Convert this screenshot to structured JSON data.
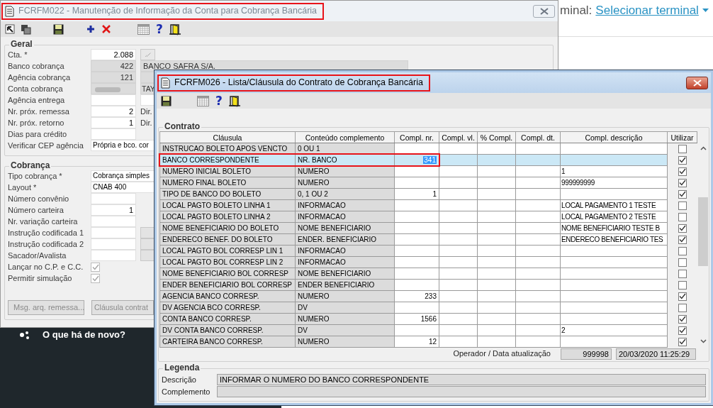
{
  "backdrop": {
    "terminal_prefix": "minal:",
    "terminal_link": "Selecionar terminal",
    "news_label": "O que há de novo?"
  },
  "account_window": {
    "title": "FCRFM022 - Manutenção de Informação da Conta para Cobrança Bancária",
    "active": false,
    "marked": true,
    "toolbar": [
      {
        "kind": "pointer"
      },
      {
        "kind": "windows"
      },
      {
        "kind": "save"
      },
      {
        "kind": "add"
      },
      {
        "kind": "delete"
      },
      {
        "kind": "grid"
      },
      {
        "kind": "help",
        "label": "?"
      },
      {
        "kind": "exit"
      }
    ],
    "sections": [
      {
        "title": "Geral",
        "rows": [
          {
            "kind": "fields",
            "label": "Cta. *",
            "fields": [
              {
                "kind": "number",
                "value": "2.088",
                "readonly": false
              },
              {
                "kind": "lookup"
              }
            ]
          },
          {
            "kind": "fields",
            "label": "Banco cobrança",
            "fields": [
              {
                "kind": "number",
                "value": "422",
                "readonly": true
              },
              {
                "kind": "text",
                "value": "BANCO SAFRA S/A.",
                "readonly": true
              }
            ]
          },
          {
            "kind": "fields",
            "label": "Agência cobrança",
            "fields": [
              {
                "kind": "number",
                "value": "121",
                "readonly": true
              },
              {
                "kind": "stub",
                "readonly": true
              }
            ]
          },
          {
            "kind": "fields",
            "label": "Conta cobrança",
            "fields": [
              {
                "kind": "blurred",
                "readonly": true
              },
              {
                "kind": "stub",
                "value": "TAY",
                "readonly": true
              }
            ]
          },
          {
            "kind": "fields",
            "label": "Agência entrega",
            "fields": [
              {
                "kind": "number",
                "readonly": false
              },
              {
                "kind": "stub",
                "readonly": false
              }
            ]
          },
          {
            "kind": "fields",
            "label": "Nr. próx. remessa",
            "fields": [
              {
                "kind": "number",
                "value": "2",
                "readonly": false
              },
              {
                "kind": "note",
                "value": "Dir."
              }
            ]
          },
          {
            "kind": "fields",
            "label": "Nr. próx. retorno",
            "fields": [
              {
                "kind": "number",
                "value": "1",
                "readonly": false
              },
              {
                "kind": "note",
                "value": "Dir."
              }
            ]
          },
          {
            "kind": "fields",
            "label": "Dias para crédito",
            "fields": [
              {
                "kind": "number",
                "readonly": false
              }
            ]
          },
          {
            "kind": "fields",
            "label": "Verificar CEP agência",
            "fields": [
              {
                "kind": "combo",
                "value": "Própria e bco. cor",
                "readonly": false
              }
            ]
          }
        ]
      },
      {
        "title": "Cobrança",
        "rows": [
          {
            "kind": "fields",
            "label": "Tipo cobrança *",
            "fields": [
              {
                "kind": "combo",
                "value": "Cobrança simples",
                "readonly": false
              }
            ]
          },
          {
            "kind": "fields",
            "label": "Layout *",
            "fields": [
              {
                "kind": "combo",
                "value": "CNAB 400",
                "readonly": false
              }
            ]
          },
          {
            "kind": "fields",
            "label": "Número convênio",
            "fields": [
              {
                "kind": "number",
                "readonly": false
              }
            ]
          },
          {
            "kind": "fields",
            "label": "Número carteira",
            "fields": [
              {
                "kind": "number",
                "value": "1",
                "readonly": false
              }
            ]
          },
          {
            "kind": "fields",
            "label": "Nr. variação carteira",
            "fields": [
              {
                "kind": "number",
                "readonly": false
              }
            ]
          },
          {
            "kind": "fields",
            "label": "Instrução codificada 1",
            "fields": [
              {
                "kind": "number",
                "readonly": false
              },
              {
                "kind": "pick"
              }
            ]
          },
          {
            "kind": "fields",
            "label": "Instrução codificada 2",
            "fields": [
              {
                "kind": "number",
                "readonly": false
              },
              {
                "kind": "pick"
              }
            ]
          },
          {
            "kind": "fields",
            "label": "Sacador/Avalista",
            "fields": [
              {
                "kind": "number",
                "readonly": false
              },
              {
                "kind": "pick"
              }
            ]
          },
          {
            "kind": "check",
            "label": "Lançar no C.P. e C.C.",
            "checked": true,
            "disabled": true
          },
          {
            "kind": "check",
            "label": "Permitir simulação",
            "checked": true,
            "disabled": true
          }
        ]
      }
    ],
    "buttons": [
      {
        "label": "Msg. arq. remessa...",
        "disabled": true
      },
      {
        "label": "Cláusula contrat",
        "disabled": true
      }
    ]
  },
  "clause_window": {
    "title": "FCRFM026 - Lista/Cláusula do Contrato de Cobrança Bancária",
    "active": true,
    "marked": true,
    "toolbar": [
      {
        "kind": "save"
      },
      {
        "kind": "grid"
      },
      {
        "kind": "help",
        "label": "?"
      },
      {
        "kind": "exit"
      }
    ],
    "group_title": "Contrato",
    "columns": [
      "Cláusula",
      "Conteúdo complemento",
      "Compl. nr.",
      "Compl. vl.",
      "% Compl.",
      "Compl. dt.",
      "Compl. descrição",
      "Utilizar"
    ],
    "rows": [
      {
        "clause": "INSTRUCAO BOLETO APOS VENCTO",
        "content": "0 OU 1",
        "use": false,
        "selected": false,
        "marked": false
      },
      {
        "clause": "BANCO CORRESPONDENTE",
        "content": "NR. BANCO",
        "number": "341",
        "use": true,
        "selected": true,
        "marked": true
      },
      {
        "clause": "NUMERO INICIAL BOLETO",
        "content": "NUMERO",
        "description": "1",
        "use": true,
        "selected": false,
        "marked": false
      },
      {
        "clause": "NUMERO FINAL BOLETO",
        "content": "NUMERO",
        "description": "999999999",
        "use": true,
        "selected": false,
        "marked": false
      },
      {
        "clause": "TIPO DE BANCO DO BOLETO",
        "content": "0, 1 OU 2",
        "number": "1",
        "use": true,
        "selected": false,
        "marked": false
      },
      {
        "clause": "LOCAL PAGTO BOLETO LINHA 1",
        "content": "INFORMACAO",
        "description": "LOCAL PAGAMENTO 1 TESTE",
        "use": false,
        "selected": false,
        "marked": false
      },
      {
        "clause": "LOCAL PAGTO BOLETO LINHA 2",
        "content": "INFORMACAO",
        "description": "LOCAL PAGAMENTO 2 TESTE",
        "use": false,
        "selected": false,
        "marked": false
      },
      {
        "clause": "NOME BENEFICIARIO DO BOLETO",
        "content": "NOME BENEFICIARIO",
        "description": "NOME BENEFICIARIO TESTE B",
        "use": true,
        "selected": false,
        "marked": false
      },
      {
        "clause": "ENDERECO BENEF. DO BOLETO",
        "content": "ENDER. BENEFICIARIO",
        "description": "ENDERECO BENEFICIARIO TES",
        "use": true,
        "selected": false,
        "marked": false
      },
      {
        "clause": "LOCAL PAGTO BOL CORRESP LIN 1",
        "content": "INFORMACAO",
        "use": false,
        "selected": false,
        "marked": false
      },
      {
        "clause": "LOCAL PAGTO BOL CORRESP LIN 2",
        "content": "INFORMACAO",
        "use": false,
        "selected": false,
        "marked": false
      },
      {
        "clause": "NOME BENEFICIARIO BOL CORRESP",
        "content": "NOME BENEFICIARIO",
        "use": false,
        "selected": false,
        "marked": false
      },
      {
        "clause": "ENDER BENEFICIARIO BOL CORRESP",
        "content": "ENDER BENEFICIARIO",
        "use": false,
        "selected": false,
        "marked": false
      },
      {
        "clause": "AGENCIA BANCO CORRESP.",
        "content": "NUMERO",
        "number": "233",
        "use": true,
        "selected": false,
        "marked": false
      },
      {
        "clause": "DV AGENCIA BCO CORRESP.",
        "content": "DV",
        "use": false,
        "selected": false,
        "marked": false
      },
      {
        "clause": "CONTA BANCO CORRESP.",
        "content": "NUMERO",
        "number": "1566",
        "use": true,
        "selected": false,
        "marked": false
      },
      {
        "clause": "DV CONTA BANCO CORRESP.",
        "content": "DV",
        "description": "2",
        "use": true,
        "selected": false,
        "marked": false
      },
      {
        "clause": "CARTEIRA BANCO CORRESP.",
        "content": "NUMERO",
        "number": "12",
        "use": true,
        "selected": false,
        "marked": false
      }
    ],
    "update_label": "Operador / Data atualização",
    "operator": "999998",
    "updated_at": "20/03/2020 11:25:29",
    "legend": {
      "title": "Legenda",
      "description_label": "Descrição",
      "description": "INFORMAR O NUMERO DO BANCO CORRESPONDENTE",
      "complement_label": "Complemento"
    }
  }
}
